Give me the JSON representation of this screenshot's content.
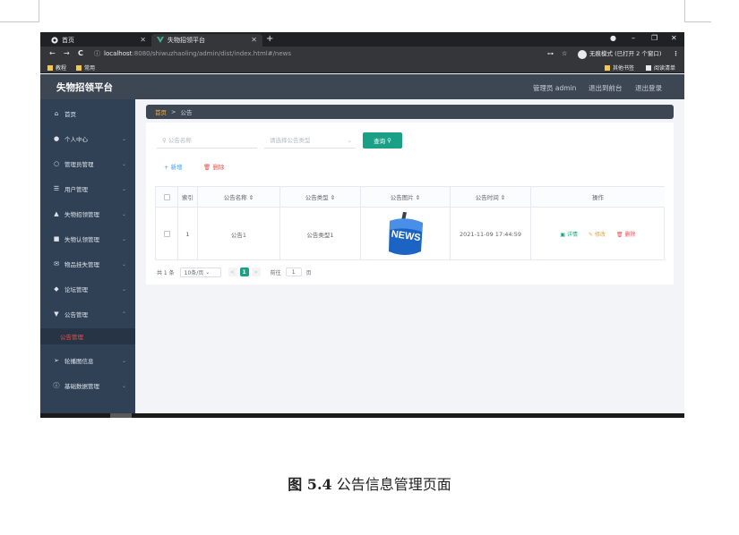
{
  "browser": {
    "tabs": [
      {
        "label": "首页",
        "active": false
      },
      {
        "label": "失物招领平台",
        "active": true
      }
    ],
    "new_tab": "+",
    "window_controls": {
      "minimize": "–",
      "restore": "❐",
      "close": "✕"
    },
    "nav": {
      "back": "←",
      "forward": "→",
      "reload": "C"
    },
    "url": {
      "info": "ⓘ",
      "host": "localhost",
      "path": ":8080/shiwuzhaoling/admin/dist/index.html#/news"
    },
    "url_actions": {
      "key": "⊶",
      "star": "☆"
    },
    "incognito": "无痕模式 (已打开 2 个窗口)",
    "menu": "⋮",
    "bookmarks": [
      {
        "label": "教程"
      },
      {
        "label": "常用"
      }
    ],
    "bookmarks_right": [
      {
        "label": "其他书签"
      },
      {
        "label": "阅读清单"
      }
    ]
  },
  "app": {
    "brand": "失物招领平台",
    "header_links": {
      "admin": "管理员 admin",
      "to_front": "退出到前台",
      "logout": "退出登录"
    },
    "sidebar": {
      "items": [
        {
          "icon": "home-icon",
          "glyph": "⌂",
          "label": "首页",
          "arrow": ""
        },
        {
          "icon": "user-icon",
          "glyph": "●",
          "label": "个人中心",
          "arrow": "⌄"
        },
        {
          "icon": "circle-icon",
          "glyph": "○",
          "label": "管理员管理",
          "arrow": "⌄"
        },
        {
          "icon": "sliders-icon",
          "glyph": "☰",
          "label": "用户管理",
          "arrow": "⌄"
        },
        {
          "icon": "bank-icon",
          "glyph": "▲",
          "label": "失物招领管理",
          "arrow": "⌄"
        },
        {
          "icon": "doc-icon",
          "glyph": "■",
          "label": "失物认领管理",
          "arrow": "⌄"
        },
        {
          "icon": "mail-icon",
          "glyph": "✉",
          "label": "物品挂失管理",
          "arrow": "⌄"
        },
        {
          "icon": "forum-icon",
          "glyph": "◆",
          "label": "论坛管理",
          "arrow": "⌄"
        },
        {
          "icon": "notice-icon",
          "glyph": "▼",
          "label": "公告管理",
          "arrow": "⌃"
        },
        {
          "icon": "",
          "glyph": "",
          "label": "公告管理",
          "arrow": ""
        },
        {
          "icon": "send-icon",
          "glyph": "➢",
          "label": "轮播图信息",
          "arrow": "⌄"
        },
        {
          "icon": "info-icon",
          "glyph": "ⓘ",
          "label": "基础数据管理",
          "arrow": "⌄"
        }
      ]
    },
    "breadcrumb": {
      "home": "首页",
      "sep": ">",
      "current": "公告"
    },
    "search": {
      "name_placeholder": "公告名称",
      "type_placeholder": "请选择公告类型",
      "button": "查询"
    },
    "actions": {
      "add": "+ 新增",
      "delete": "删除"
    },
    "table": {
      "headers": [
        "",
        "索引",
        "公告名称 ⇕",
        "公告类型 ⇕",
        "公告图片 ⇕",
        "公告时间 ⇕",
        "操作"
      ],
      "rows": [
        {
          "index": "1",
          "name": "公告1",
          "type": "公告类型1",
          "image_text": "NEWS",
          "time": "2021-11-09 17:44:59",
          "ops": [
            "详情",
            "修改",
            "删除"
          ]
        }
      ]
    },
    "pager": {
      "total": "共 1 条",
      "size": "10条/页",
      "prev": "<",
      "page": "1",
      "next": ">",
      "goto_label": "前往",
      "goto_value": "1",
      "page_unit": "页"
    }
  },
  "caption": {
    "num": "图 5.4",
    "text": "公告信息管理页面"
  },
  "colors": {
    "accent": "#19a086",
    "sidebar": "#304156",
    "header": "#3d4653",
    "danger": "#e84f4f",
    "link": "#409eff"
  }
}
